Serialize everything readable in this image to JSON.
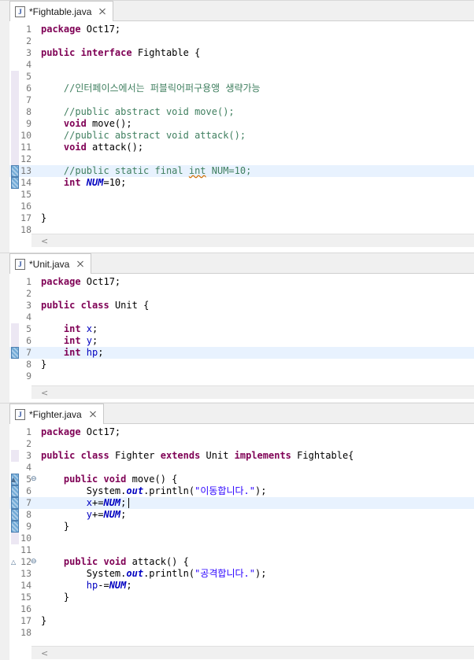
{
  "editors": [
    {
      "tab": {
        "icon": "J",
        "title": "*Fightable.java"
      },
      "lines": [
        {
          "n": "1",
          "segs": [
            [
              "kw",
              "package"
            ],
            [
              "",
              "Oct17;"
            ]
          ]
        },
        {
          "n": "2",
          "segs": []
        },
        {
          "n": "3",
          "segs": [
            [
              "kw",
              "public"
            ],
            [
              "kw",
              "interface"
            ],
            [
              "",
              "Fightable {"
            ]
          ]
        },
        {
          "n": "4",
          "segs": []
        },
        {
          "n": "5",
          "segs": []
        },
        {
          "n": "6",
          "segs": [
            [
              "cm",
              "    //인터페이스에서는 퍼블릭어퍼구용앵 생략가능"
            ]
          ]
        },
        {
          "n": "7",
          "segs": []
        },
        {
          "n": "8",
          "segs": [
            [
              "cm",
              "    //public abstract void move();"
            ]
          ]
        },
        {
          "n": "9",
          "segs": [
            [
              "kw",
              "    void"
            ],
            [
              "",
              "move();"
            ]
          ]
        },
        {
          "n": "10",
          "segs": [
            [
              "cm",
              "    //public abstract void attack();"
            ]
          ]
        },
        {
          "n": "11",
          "segs": [
            [
              "kw",
              "    void"
            ],
            [
              "",
              "attack();"
            ]
          ]
        },
        {
          "n": "12",
          "segs": []
        },
        {
          "n": "13",
          "segs": [
            [
              "cm",
              "    //public static final "
            ],
            [
              "cm typo",
              "int"
            ],
            [
              "cm",
              " NUM=10;"
            ]
          ]
        },
        {
          "n": "14",
          "segs": [
            [
              "kw",
              "    int"
            ],
            [
              "sfld",
              "NUM"
            ],
            [
              "",
              "=10;"
            ]
          ]
        },
        {
          "n": "15",
          "segs": []
        },
        {
          "n": "16",
          "segs": []
        },
        {
          "n": "17",
          "segs": [
            [
              "",
              "}"
            ]
          ]
        },
        {
          "n": "18",
          "segs": []
        }
      ]
    },
    {
      "tab": {
        "icon": "J",
        "title": "*Unit.java"
      },
      "lines": [
        {
          "n": "1",
          "segs": [
            [
              "kw",
              "package"
            ],
            [
              "",
              "Oct17;"
            ]
          ]
        },
        {
          "n": "2",
          "segs": []
        },
        {
          "n": "3",
          "segs": [
            [
              "kw",
              "public"
            ],
            [
              "kw",
              "class"
            ],
            [
              "",
              "Unit {"
            ]
          ]
        },
        {
          "n": "4",
          "segs": []
        },
        {
          "n": "5",
          "segs": [
            [
              "kw",
              "    int"
            ],
            [
              "fld",
              "x"
            ],
            [
              "",
              ";"
            ]
          ]
        },
        {
          "n": "6",
          "segs": [
            [
              "kw",
              "    int"
            ],
            [
              "fld",
              "y"
            ],
            [
              "",
              ";"
            ]
          ]
        },
        {
          "n": "7",
          "segs": [
            [
              "kw",
              "    int"
            ],
            [
              "fld",
              "hp"
            ],
            [
              "",
              ";"
            ]
          ]
        },
        {
          "n": "8",
          "segs": [
            [
              "",
              "}"
            ]
          ]
        },
        {
          "n": "9",
          "segs": []
        }
      ]
    },
    {
      "tab": {
        "icon": "J",
        "title": "*Fighter.java"
      },
      "lines": [
        {
          "n": "1",
          "segs": [
            [
              "kw",
              "package"
            ],
            [
              "",
              "Oct17;"
            ]
          ]
        },
        {
          "n": "2",
          "segs": []
        },
        {
          "n": "3",
          "segs": [
            [
              "kw",
              "public"
            ],
            [
              "kw",
              "class"
            ],
            [
              "",
              "Fighter"
            ],
            [
              "kw",
              "extends"
            ],
            [
              "",
              "Unit"
            ],
            [
              "kw",
              "implements"
            ],
            [
              "",
              "Fightable{"
            ]
          ]
        },
        {
          "n": "4",
          "segs": []
        },
        {
          "n": "5",
          "segs": [
            [
              "kw",
              "    public"
            ],
            [
              "kw",
              "void"
            ],
            [
              "",
              "move() {"
            ]
          ]
        },
        {
          "n": "6",
          "segs": [
            [
              "",
              "        System."
            ],
            [
              "sfld",
              "out"
            ],
            [
              "",
              ".println("
            ],
            [
              "str",
              "\"이동합니다.\""
            ],
            [
              "",
              ");"
            ]
          ]
        },
        {
          "n": "7",
          "segs": [
            [
              "fld",
              "        x"
            ],
            [
              "",
              "+="
            ],
            [
              "sfld",
              "NUM"
            ],
            [
              "",
              ";"
            ]
          ]
        },
        {
          "n": "8",
          "segs": [
            [
              "fld",
              "        y"
            ],
            [
              "",
              "+="
            ],
            [
              "sfld",
              "NUM"
            ],
            [
              "",
              ";"
            ]
          ]
        },
        {
          "n": "9",
          "segs": [
            [
              "",
              "    }"
            ]
          ]
        },
        {
          "n": "10",
          "segs": []
        },
        {
          "n": "11",
          "segs": []
        },
        {
          "n": "12",
          "segs": [
            [
              "kw",
              "    public"
            ],
            [
              "kw",
              "void"
            ],
            [
              "",
              "attack() {"
            ]
          ]
        },
        {
          "n": "13",
          "segs": [
            [
              "",
              "        System."
            ],
            [
              "sfld",
              "out"
            ],
            [
              "",
              ".println("
            ],
            [
              "str",
              "\"공격합니다.\""
            ],
            [
              "",
              ");"
            ]
          ]
        },
        {
          "n": "14",
          "segs": [
            [
              "fld",
              "        hp"
            ],
            [
              "",
              "-="
            ],
            [
              "sfld",
              "NUM"
            ],
            [
              "",
              ";"
            ]
          ]
        },
        {
          "n": "15",
          "segs": [
            [
              "",
              "    }"
            ]
          ]
        },
        {
          "n": "16",
          "segs": []
        },
        {
          "n": "17",
          "segs": [
            [
              "",
              "}"
            ]
          ]
        },
        {
          "n": "18",
          "segs": []
        }
      ]
    }
  ],
  "scroll_arrow": "<"
}
